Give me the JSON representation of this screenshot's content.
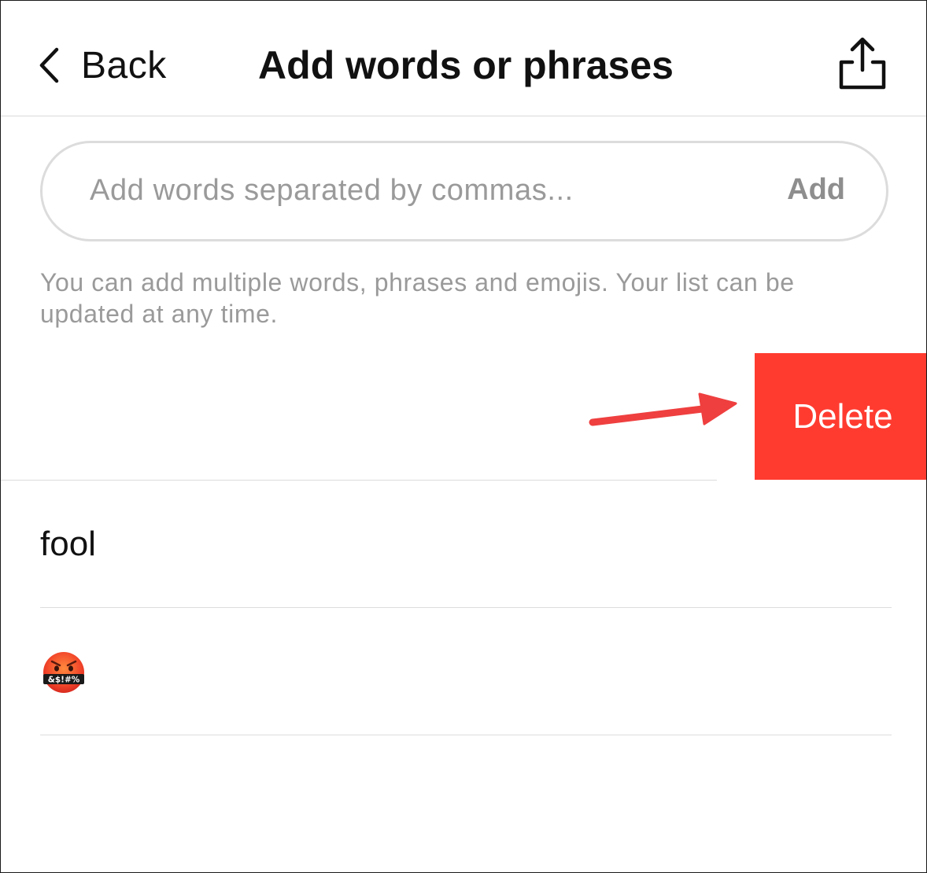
{
  "header": {
    "back_label": "Back",
    "title": "Add words or phrases",
    "share_icon": "share-icon"
  },
  "input": {
    "placeholder": "Add words separated by commas...",
    "value": "",
    "add_label": "Add"
  },
  "helper_text": "You can add multiple words, phrases and emojis. Your list can be updated at any time.",
  "swipe_action": {
    "delete_label": "Delete",
    "color": "#ff3b30"
  },
  "items": [
    {
      "label": "fool"
    },
    {
      "label": "",
      "icon": "face-with-symbols-on-mouth-emoji",
      "emoji_text": "&$!#%"
    }
  ],
  "colors": {
    "delete": "#ff3b30",
    "arrow": "#ef3f3f",
    "placeholder": "#9a9a9a",
    "divider": "#dcdcdc"
  }
}
